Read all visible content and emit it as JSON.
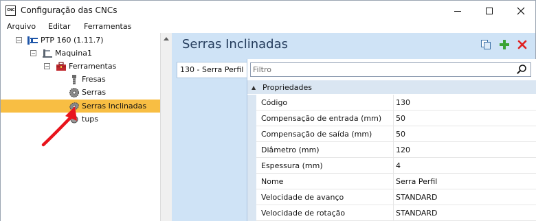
{
  "window": {
    "title": "Configuração das CNCs",
    "app_icon_text": "CNC"
  },
  "menu": {
    "items": [
      {
        "label": "Arquivo"
      },
      {
        "label": "Editar"
      },
      {
        "label": "Ferramentas"
      }
    ]
  },
  "tree": {
    "nodes": [
      {
        "label": "PTP 160 (1.11.7)",
        "icon": "machine-controller-icon",
        "expander": "⊟"
      },
      {
        "label": "Maquina1",
        "icon": "machine-icon",
        "expander": "⊟"
      },
      {
        "label": "Ferramentas",
        "icon": "toolbox-icon",
        "expander": "⊟"
      },
      {
        "label": "Fresas",
        "icon": "mill-bit-icon"
      },
      {
        "label": "Serras",
        "icon": "saw-blade-icon"
      },
      {
        "label": "Serras Inclinadas",
        "icon": "inclined-saw-icon",
        "selected": true
      },
      {
        "label": "tups",
        "icon": "setup-icon"
      }
    ]
  },
  "panel": {
    "title": "Serras Inclinadas",
    "tools": [
      "copy-icon",
      "add-icon",
      "delete-icon"
    ],
    "tabs": [
      {
        "label": "130 - Serra Perfil"
      }
    ],
    "filter_placeholder": "Filtro",
    "category": "Propriedades",
    "properties": [
      {
        "name": "Código",
        "value": "130"
      },
      {
        "name": "Compensação de entrada (mm)",
        "value": "50"
      },
      {
        "name": "Compensação de saída (mm)",
        "value": "50"
      },
      {
        "name": "Diâmetro (mm)",
        "value": "120"
      },
      {
        "name": "Espessura (mm)",
        "value": "4"
      },
      {
        "name": "Nome",
        "value": "Serra Perfil"
      },
      {
        "name": "Velocidade de avanço",
        "value": "STANDARD"
      },
      {
        "name": "Velocidade de rotação",
        "value": "STANDARD"
      }
    ]
  },
  "colors": {
    "selection": "#f8be43",
    "panel_bg": "#cfe3f6",
    "title_text": "#243c5c",
    "annotation_arrow": "#e8141c"
  }
}
